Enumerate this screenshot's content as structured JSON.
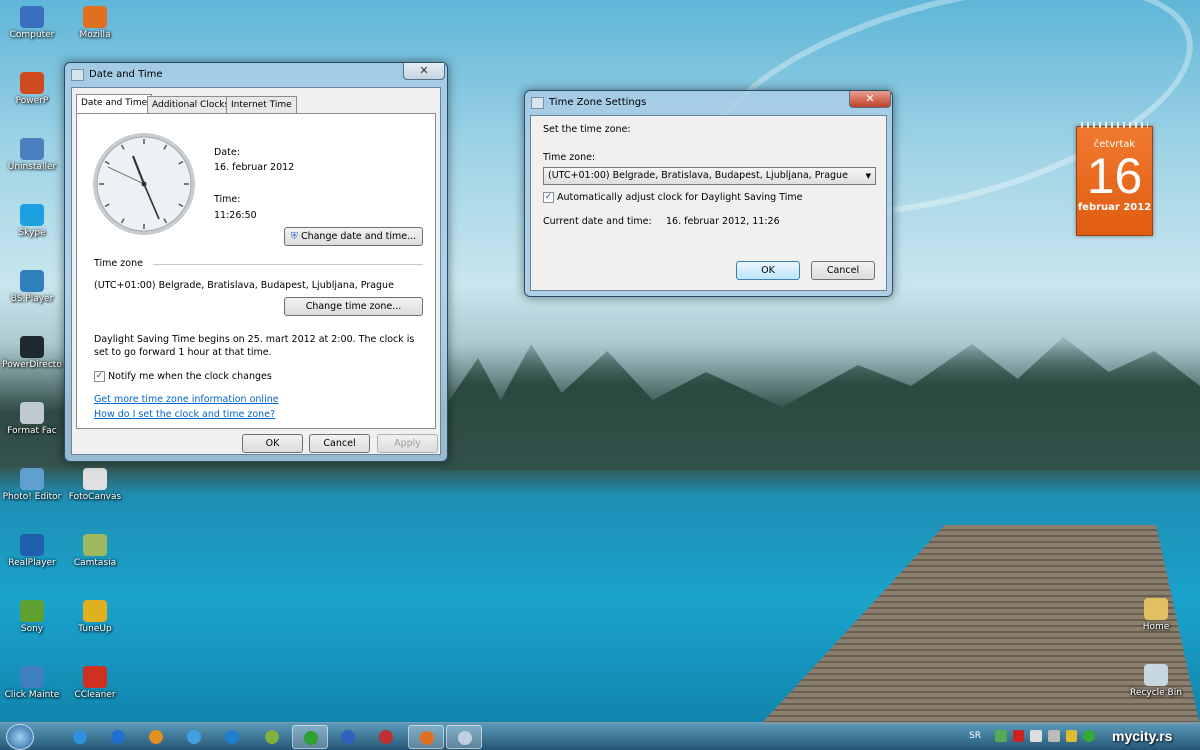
{
  "desktop": {
    "icons": [
      {
        "label": "Computer",
        "icon": "computer-icon",
        "color": "#3a6fc0"
      },
      {
        "label": "Mozilla",
        "icon": "firefox-icon",
        "color": "#e07020"
      },
      {
        "label": "PowerP",
        "icon": "powerpoint-icon",
        "color": "#d04a20"
      },
      {
        "label": "Uninstaller",
        "icon": "uninstaller-icon",
        "color": "#4a80c0"
      },
      {
        "label": "Skype",
        "icon": "skype-icon",
        "color": "#1da0e0"
      },
      {
        "label": "BS.Player",
        "icon": "bsplayer-icon",
        "color": "#3080c0"
      },
      {
        "label": "PowerDirecto",
        "icon": "powerdirector-icon",
        "color": "#202830"
      },
      {
        "label": "Format Fac",
        "icon": "format-factory-icon",
        "color": "#c0c8d0"
      },
      {
        "label": "Photo! Editor",
        "icon": "photo-editor-icon",
        "color": "#60a0d0"
      },
      {
        "label": "FotoCanvas",
        "icon": "fotocanvas-icon",
        "color": "#e0e0e0"
      },
      {
        "label": "RealPlayer",
        "icon": "realplayer-icon",
        "color": "#2060b0"
      },
      {
        "label": "Camtasia",
        "icon": "camtasia-icon",
        "color": "#a0b860"
      },
      {
        "label": "Sony",
        "icon": "sony-icon",
        "color": "#60a030"
      },
      {
        "label": "TuneUp",
        "icon": "tuneup-icon",
        "color": "#e0b020"
      },
      {
        "label": "Click Mainte",
        "icon": "click-maintenance-icon",
        "color": "#4080c0"
      },
      {
        "label": "CCleaner",
        "icon": "ccleaner-icon",
        "color": "#d03020"
      },
      {
        "label": "Home",
        "icon": "folder-icon",
        "color": "#e0c060"
      },
      {
        "label": "Recycle Bin",
        "icon": "recycle-bin-icon",
        "color": "#c8d8e0"
      }
    ]
  },
  "calendar_gadget": {
    "weekday": "četvrtak",
    "day": "16",
    "month_year": "februar 2012"
  },
  "date_time_dialog": {
    "title": "Date and Time",
    "close": "✕",
    "tabs": [
      "Date and Time",
      "Additional Clocks",
      "Internet Time"
    ],
    "date_label": "Date:",
    "date_value": "16. februar 2012",
    "time_label": "Time:",
    "time_value": "11:26:50",
    "change_date_button": "Change date and time...",
    "timezone_heading": "Time zone",
    "timezone_value": "(UTC+01:00) Belgrade, Bratislava, Budapest, Ljubljana, Prague",
    "change_timezone_button": "Change time zone...",
    "dst_text": "Daylight Saving Time begins on 25. mart 2012 at 2:00. The clock is set to go forward 1 hour at that time.",
    "notify_label": "Notify me when the clock changes",
    "notify_checked": true,
    "link_more": "Get more time zone information online",
    "link_howto": "How do I set the clock and time zone?",
    "ok": "OK",
    "cancel": "Cancel",
    "apply": "Apply"
  },
  "timezone_dialog": {
    "title": "Time Zone Settings",
    "close": "✕",
    "heading": "Set the time zone:",
    "timezone_label": "Time zone:",
    "timezone_selected": "(UTC+01:00) Belgrade, Bratislava, Budapest, Ljubljana, Prague",
    "auto_dst_label": "Automatically adjust clock for Daylight Saving Time",
    "auto_dst_checked": true,
    "current_label": "Current date and time:",
    "current_value": "16. februar 2012, 11:26",
    "ok": "OK",
    "cancel": "Cancel"
  },
  "taskbar": {
    "language": "SR",
    "watermark": "mycity.rs",
    "apps": [
      {
        "name": "internet-explorer",
        "color": "#3090e0",
        "open": false
      },
      {
        "name": "app-blue",
        "color": "#2070d0",
        "open": false
      },
      {
        "name": "app-orange",
        "color": "#e09020",
        "open": false
      },
      {
        "name": "app-search",
        "color": "#40a0e0",
        "open": false
      },
      {
        "name": "app-teamviewer",
        "color": "#2080d0",
        "open": false
      },
      {
        "name": "app-shield",
        "color": "#80b040",
        "open": false
      },
      {
        "name": "utorrent",
        "color": "#30a030",
        "open": true
      },
      {
        "name": "app-globe",
        "color": "#3060c0",
        "open": false
      },
      {
        "name": "app-red",
        "color": "#c03030",
        "open": false
      },
      {
        "name": "firefox",
        "color": "#e07020",
        "open": true
      },
      {
        "name": "date-time-control-panel",
        "color": "#c0d0e0",
        "open": true
      }
    ]
  }
}
